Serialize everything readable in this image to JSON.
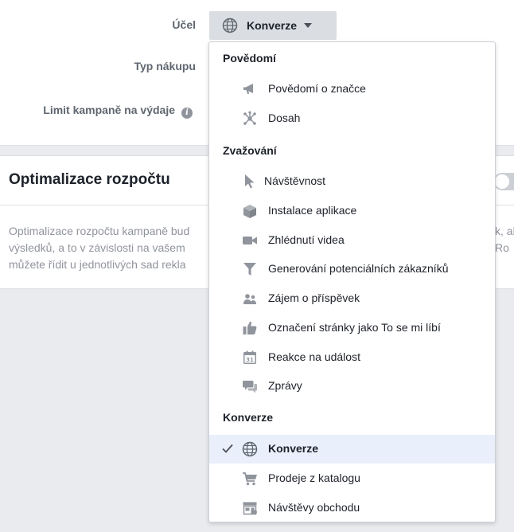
{
  "form": {
    "ucel_label": "Účel",
    "typ_nakupu_label": "Typ nákupu",
    "limit_label": "Limit kampaně na výdaje",
    "info_glyph": "i",
    "objective_value": "Konverze"
  },
  "budget": {
    "title": "Optimalizace rozpočtu",
    "text_left": [
      "Optimalizace rozpočtu kampaně bud",
      "výsledků, a to v závislosti na vašem",
      "můžete řídit u jednotlivých sad rekla"
    ],
    "text_right": [
      "k, al",
      "Ro"
    ]
  },
  "dropdown": {
    "groups": [
      {
        "header": "Povědomí",
        "items": [
          {
            "label": "Povědomí o značce",
            "icon": "megaphone-icon"
          },
          {
            "label": "Dosah",
            "icon": "reach-network-icon"
          }
        ]
      },
      {
        "header": "Zvažování",
        "items": [
          {
            "label": "Návštěvnost",
            "icon": "cursor-icon"
          },
          {
            "label": "Instalace aplikace",
            "icon": "cube-icon"
          },
          {
            "label": "Zhlédnutí videa",
            "icon": "video-camera-icon"
          },
          {
            "label": "Generování potenciálních zákazníků",
            "icon": "funnel-icon"
          },
          {
            "label": "Zájem o příspěvek",
            "icon": "people-icon"
          },
          {
            "label": "Označení stránky jako To se mi líbí",
            "icon": "thumbs-up-icon"
          },
          {
            "label": "Reakce na událost",
            "icon": "calendar-icon"
          },
          {
            "label": "Zprávy",
            "icon": "chat-bubbles-icon"
          }
        ]
      },
      {
        "header": "Konverze",
        "items": [
          {
            "label": "Konverze",
            "icon": "globe-icon",
            "selected": true
          },
          {
            "label": "Prodeje z katalogu",
            "icon": "shopping-cart-icon"
          },
          {
            "label": "Návštěvy obchodu",
            "icon": "store-icon"
          }
        ]
      }
    ]
  },
  "colors": {
    "icon_gray": "#90949c",
    "selected_bg": "#eaf0fb",
    "button_bg": "#dadde1",
    "page_bg": "#e9ebee"
  }
}
